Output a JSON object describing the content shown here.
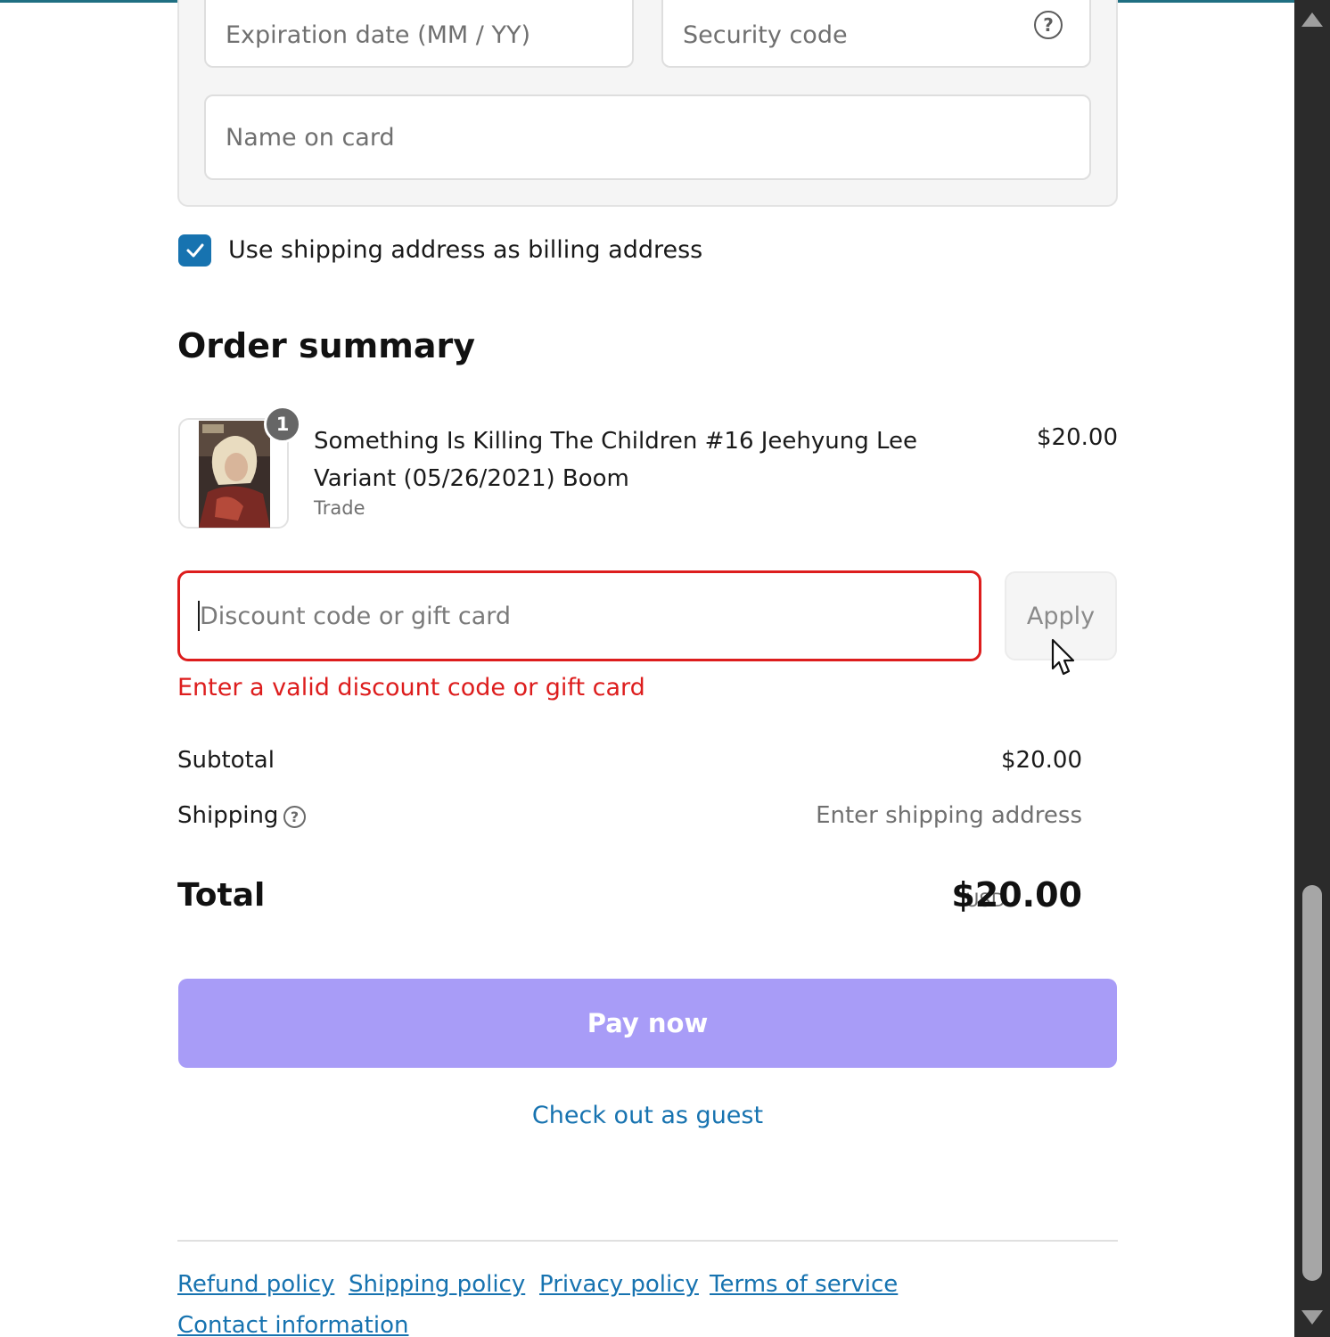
{
  "payment": {
    "expiration_placeholder": "Expiration date (MM / YY)",
    "security_placeholder": "Security code",
    "name_placeholder": "Name on card",
    "help_glyph": "?"
  },
  "billing": {
    "checkbox_checked": true,
    "checkbox_label": "Use shipping address as billing address"
  },
  "order_summary": {
    "title": "Order summary",
    "items": [
      {
        "quantity": "1",
        "title": "Something Is Killing The Children #16 Jeehyung Lee Variant (05/26/2021) Boom",
        "variant": "Trade",
        "price": "$20.00"
      }
    ],
    "discount": {
      "placeholder": "Discount code or gift card",
      "value": "",
      "apply_label": "Apply",
      "error": "Enter a valid discount code or gift card"
    },
    "subtotal_label": "Subtotal",
    "subtotal_value": "$20.00",
    "shipping_label": "Shipping",
    "shipping_value": "Enter shipping address",
    "total_label": "Total",
    "total_currency": "USD",
    "total_value": "$20.00"
  },
  "actions": {
    "pay_now": "Pay now",
    "guest": "Check out as guest"
  },
  "footer": {
    "links": [
      "Refund policy",
      "Shipping policy",
      "Privacy policy",
      "Terms of service",
      "Contact information"
    ]
  },
  "colors": {
    "accent": "#1773b0",
    "error": "#dd1d1d",
    "pay_button": "#a89cf7"
  }
}
